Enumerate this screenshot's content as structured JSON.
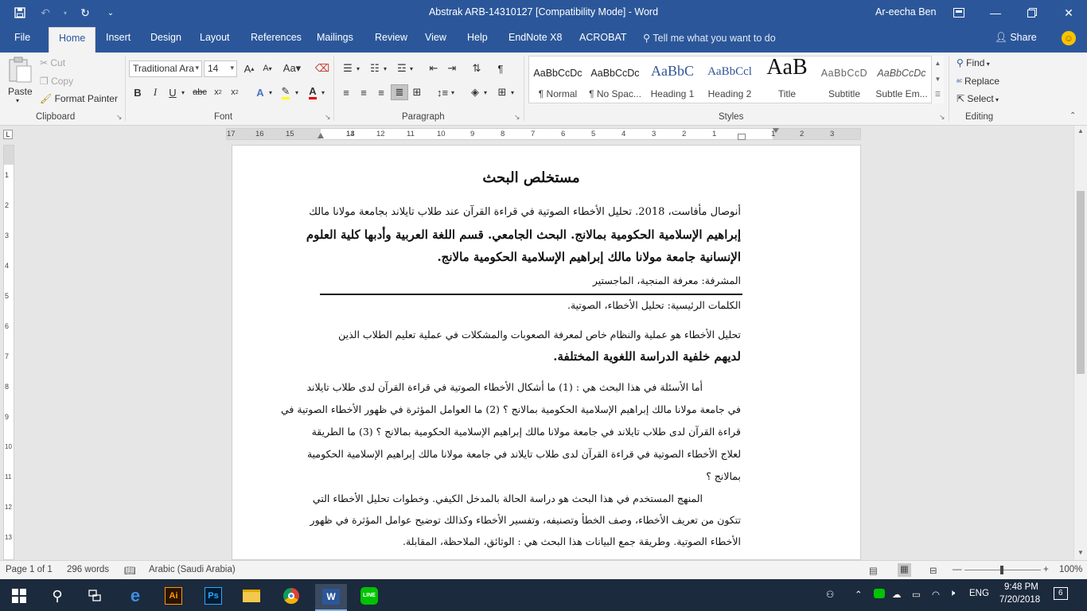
{
  "window": {
    "title": "Abstrak ARB-14310127 [Compatibility Mode]  -  Word",
    "user": "Ar-eecha Ben"
  },
  "menu": {
    "tabs": [
      "File",
      "Home",
      "Insert",
      "Design",
      "Layout",
      "References",
      "Mailings",
      "Review",
      "View",
      "Help",
      "EndNote X8",
      "ACROBAT"
    ],
    "tell_me": "Tell me what you want to do",
    "share": "Share"
  },
  "ribbon": {
    "clipboard": {
      "label": "Clipboard",
      "paste": "Paste",
      "cut": "Cut",
      "copy": "Copy",
      "format_painter": "Format Painter"
    },
    "font": {
      "label": "Font",
      "font_name": "Traditional Ara",
      "font_size": "14"
    },
    "paragraph": {
      "label": "Paragraph"
    },
    "styles": {
      "label": "Styles",
      "items": [
        {
          "preview": "AaBbCcDc",
          "name": "¶ Normal"
        },
        {
          "preview": "AaBbCcDc",
          "name": "¶ No Spac..."
        },
        {
          "preview": "AaBbC",
          "name": "Heading 1"
        },
        {
          "preview": "AaBbCcl",
          "name": "Heading 2"
        },
        {
          "preview": "AaB",
          "name": "Title"
        },
        {
          "preview": "AaBbCcD",
          "name": "Subtitle"
        },
        {
          "preview": "AaBbCcDc",
          "name": "Subtle Em..."
        }
      ]
    },
    "editing": {
      "label": "Editing",
      "find": "Find",
      "replace": "Replace",
      "select": "Select"
    }
  },
  "ruler": {
    "numbers": [
      "17",
      "16",
      "15",
      "14",
      "13",
      "12",
      "11",
      "10",
      "9",
      "8",
      "7",
      "6",
      "5",
      "4",
      "3",
      "2",
      "1",
      "1",
      "2",
      "3"
    ],
    "vertical_numbers": [
      "1",
      "2",
      "3",
      "4",
      "5",
      "6",
      "7",
      "8",
      "9",
      "10",
      "11",
      "12",
      "13"
    ]
  },
  "document": {
    "heading": "مستخلص البحث",
    "lines": [
      "أنوصال مأفاست، 2018. تحليل الأخطاء الصوتية في قراءة القرآن عند طلاب تايلاند بجامعة مولانا مالك",
      "إبراهيم الإسلامية الحكومية بمالانج. البحث الجامعي. قسم اللغة العربية وأدبها كلية العلوم",
      "الإنسانية جامعة مولانا مالك إبراهيم الإسلامية الحكومية مالانج.",
      "المشرفة: معرفة المنجية، الماجستير",
      "الكلمات الرئيسية: تحليل الأخطاء، الصوتية.",
      "تحليل الأخطاء هو عملية والنظام خاص لمعرفة  الصعوبات والمشكلات في عملية  تعليم الطلاب الذين",
      "لديهم خلفية الدراسة اللغوية المختلفة.",
      "أما الأسئلة في هذا البحث هي : (1) ما أشكال الأخطاء الصوتية في قراءة القرآن لدى طلاب تايلاند",
      "في جامعة مولانا مالك إبراهيم الإسلامية الحكومية بمالانج ؟ (2) ما العوامل المؤثرة في ظهور الأخطاء الصوتية في",
      "قراءة القرآن لدى طلاب تايلاند في جامعة مولانا مالك إبراهيم الإسلامية الحكومية بمالانج ؟ (3) ما الطريقة",
      "لعلاج الأخطاء الصوتية في قراءة القرآن لدى طلاب تايلاند في جامعة مولانا مالك إبراهيم الإسلامية الحكومية",
      "بمالانج ؟",
      "المنهج المستخدم في هذا البحث هو دراسة الحالة بالمدخل الكيفي. وخطوات تحليل الأخطاء التي",
      "تتكون من تعريف الأخطاء، وصف الخطأ وتصنيفه، وتفسير الأخطاء وكذالك توضيح عوامل المؤثرة في ظهور",
      "الأخطاء الصوتية. وطريقة جمع البيانات هذا البحث هي : الوثائق، الملاحظة، المقابلة."
    ]
  },
  "status": {
    "page": "Page 1 of 1",
    "words": "296 words",
    "language": "Arabic (Saudi Arabia)",
    "zoom": "100%"
  },
  "taskbar": {
    "language": "ENG",
    "time": "9:48 PM",
    "date": "7/20/2018",
    "notifications": "6"
  },
  "colors": {
    "word_blue": "#2b579a",
    "taskbar": "#1c2a3d",
    "heading_style": "#2f5496"
  }
}
